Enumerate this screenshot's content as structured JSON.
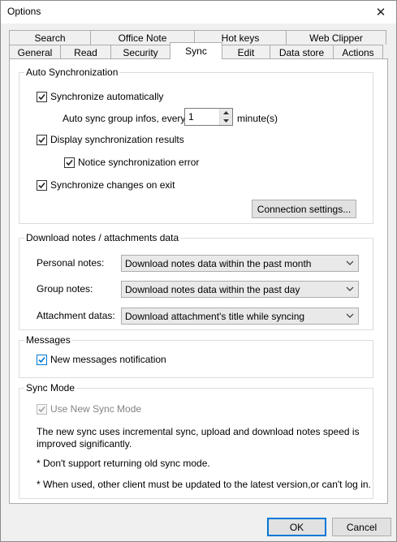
{
  "window": {
    "title": "Options",
    "close_glyph": "✕"
  },
  "tabs": {
    "row_top": [
      "Search",
      "Office Note",
      "Hot keys",
      "Web Clipper"
    ],
    "row_bottom": [
      "General",
      "Read",
      "Security",
      "Sync",
      "Edit",
      "Data store",
      "Actions"
    ],
    "active": "Sync"
  },
  "auto_sync": {
    "title": "Auto Synchronization",
    "sync_auto": {
      "label": "Synchronize automatically",
      "checked": true
    },
    "interval_label": "Auto sync group infos, every",
    "interval_value": "1",
    "interval_unit": "minute(s)",
    "display_results": {
      "label": "Display synchronization results",
      "checked": true
    },
    "notice_error": {
      "label": "Notice synchronization error",
      "checked": true
    },
    "sync_on_exit": {
      "label": "Synchronize changes on exit",
      "checked": true
    },
    "connection_button": "Connection settings..."
  },
  "download": {
    "title": "Download notes / attachments data",
    "personal_label": "Personal notes:",
    "personal_value": "Download notes data within the past month",
    "group_label": "Group notes:",
    "group_value": "Download notes data within the past day",
    "attachment_label": "Attachment datas:",
    "attachment_value": "Download attachment's title while syncing"
  },
  "messages": {
    "title": "Messages",
    "new_notification": {
      "label": "New messages notification",
      "checked": true
    }
  },
  "sync_mode": {
    "title": "Sync Mode",
    "use_new": {
      "label": "Use New Sync Mode",
      "checked": true,
      "disabled": true
    },
    "description_1": "The new sync uses incremental sync, upload and download notes speed is",
    "description_2": "improved significantly.",
    "note_1": "* Don't support returning old sync mode.",
    "note_2": "* When used, other client must be updated to the latest version,or can't log in."
  },
  "footer": {
    "ok": "OK",
    "cancel": "Cancel"
  },
  "colors": {
    "accent": "#0078d7",
    "window_bg": "#f0f0f0",
    "page_bg": "#ffffff"
  }
}
